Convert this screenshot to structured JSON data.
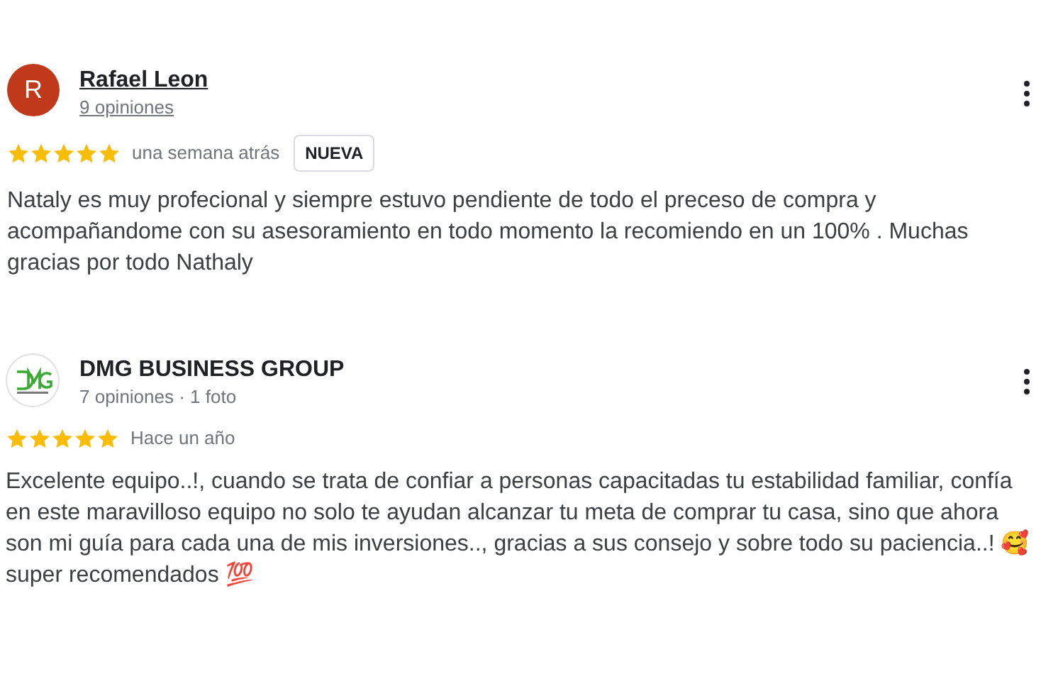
{
  "reviews": [
    {
      "avatar": {
        "kind": "letter",
        "letter": "R",
        "color": "#c0391b"
      },
      "name": "Rafael Leon",
      "name_link": true,
      "meta": "9 opiniones",
      "stars": 5,
      "time": "una semana atrás",
      "badge": "NUEVA",
      "text": "Nataly es muy profecional y siempre estuvo pendiente de todo el preceso de compra y acompañandome con su asesoramiento en todo momento la recomiendo en un 100% . Muchas gracias por todo Nathaly"
    },
    {
      "avatar": {
        "kind": "logo"
      },
      "name": "DMG BUSINESS GROUP",
      "name_link": false,
      "meta": "7 opiniones · 1 foto",
      "stars": 5,
      "time": "Hace un año",
      "text": "Excelente equipo..!, cuando se trata de confiar a personas capacitadas tu estabilidad familiar, confía en este maravilloso equipo no solo te ayudan alcanzar tu meta de comprar tu casa, sino que ahora son mi guía para cada una de mis inversiones.., gracias a sus consejo y sobre todo su paciencia..! 🥰 super recomendados 💯"
    }
  ]
}
